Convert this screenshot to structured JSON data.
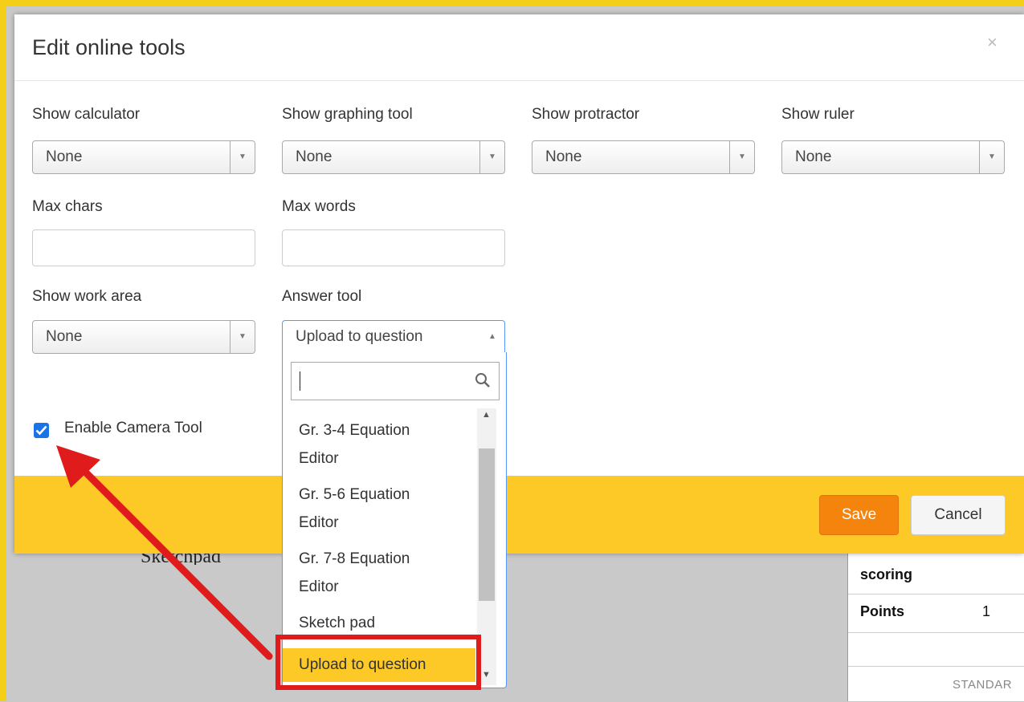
{
  "modal": {
    "title": "Edit online tools",
    "close_symbol": "×",
    "fields": {
      "calculator": {
        "label": "Show calculator",
        "value": "None"
      },
      "graphing": {
        "label": "Show graphing tool",
        "value": "None"
      },
      "protractor": {
        "label": "Show protractor",
        "value": "None"
      },
      "ruler": {
        "label": "Show ruler",
        "value": "None"
      },
      "max_chars": {
        "label": "Max chars",
        "value": ""
      },
      "max_words": {
        "label": "Max words",
        "value": ""
      },
      "work_area": {
        "label": "Show work area",
        "value": "None"
      },
      "answer_tool": {
        "label": "Answer tool",
        "value": "Upload to question"
      }
    },
    "camera_tool": {
      "label": "Enable Camera Tool",
      "checked": true
    },
    "footer": {
      "save_label": "Save",
      "cancel_label": "Cancel"
    }
  },
  "answer_dropdown": {
    "search_value": "",
    "items": [
      {
        "line1": "Gr. 3-4 Equation",
        "line2": "Editor"
      },
      {
        "line1": "Gr. 5-6 Equation",
        "line2": "Editor"
      },
      {
        "line1": "Gr. 7-8 Equation",
        "line2": "Editor"
      },
      {
        "line1": "Sketch pad",
        "line2": ""
      },
      {
        "line1": "Upload to question",
        "line2": "",
        "selected": true
      }
    ]
  },
  "background": {
    "sketchpad_text": "Sketchpad",
    "side_panel": {
      "scoring_label": "scoring",
      "points_label": "Points",
      "points_value": "1",
      "standard_label": "STANDAR"
    }
  },
  "colors": {
    "accent_yellow": "#fcc927",
    "save_orange": "#f5840c",
    "annotation_red": "#e01b1b",
    "checkbox_blue": "#1a73e8",
    "focus_blue": "#5897fb"
  }
}
